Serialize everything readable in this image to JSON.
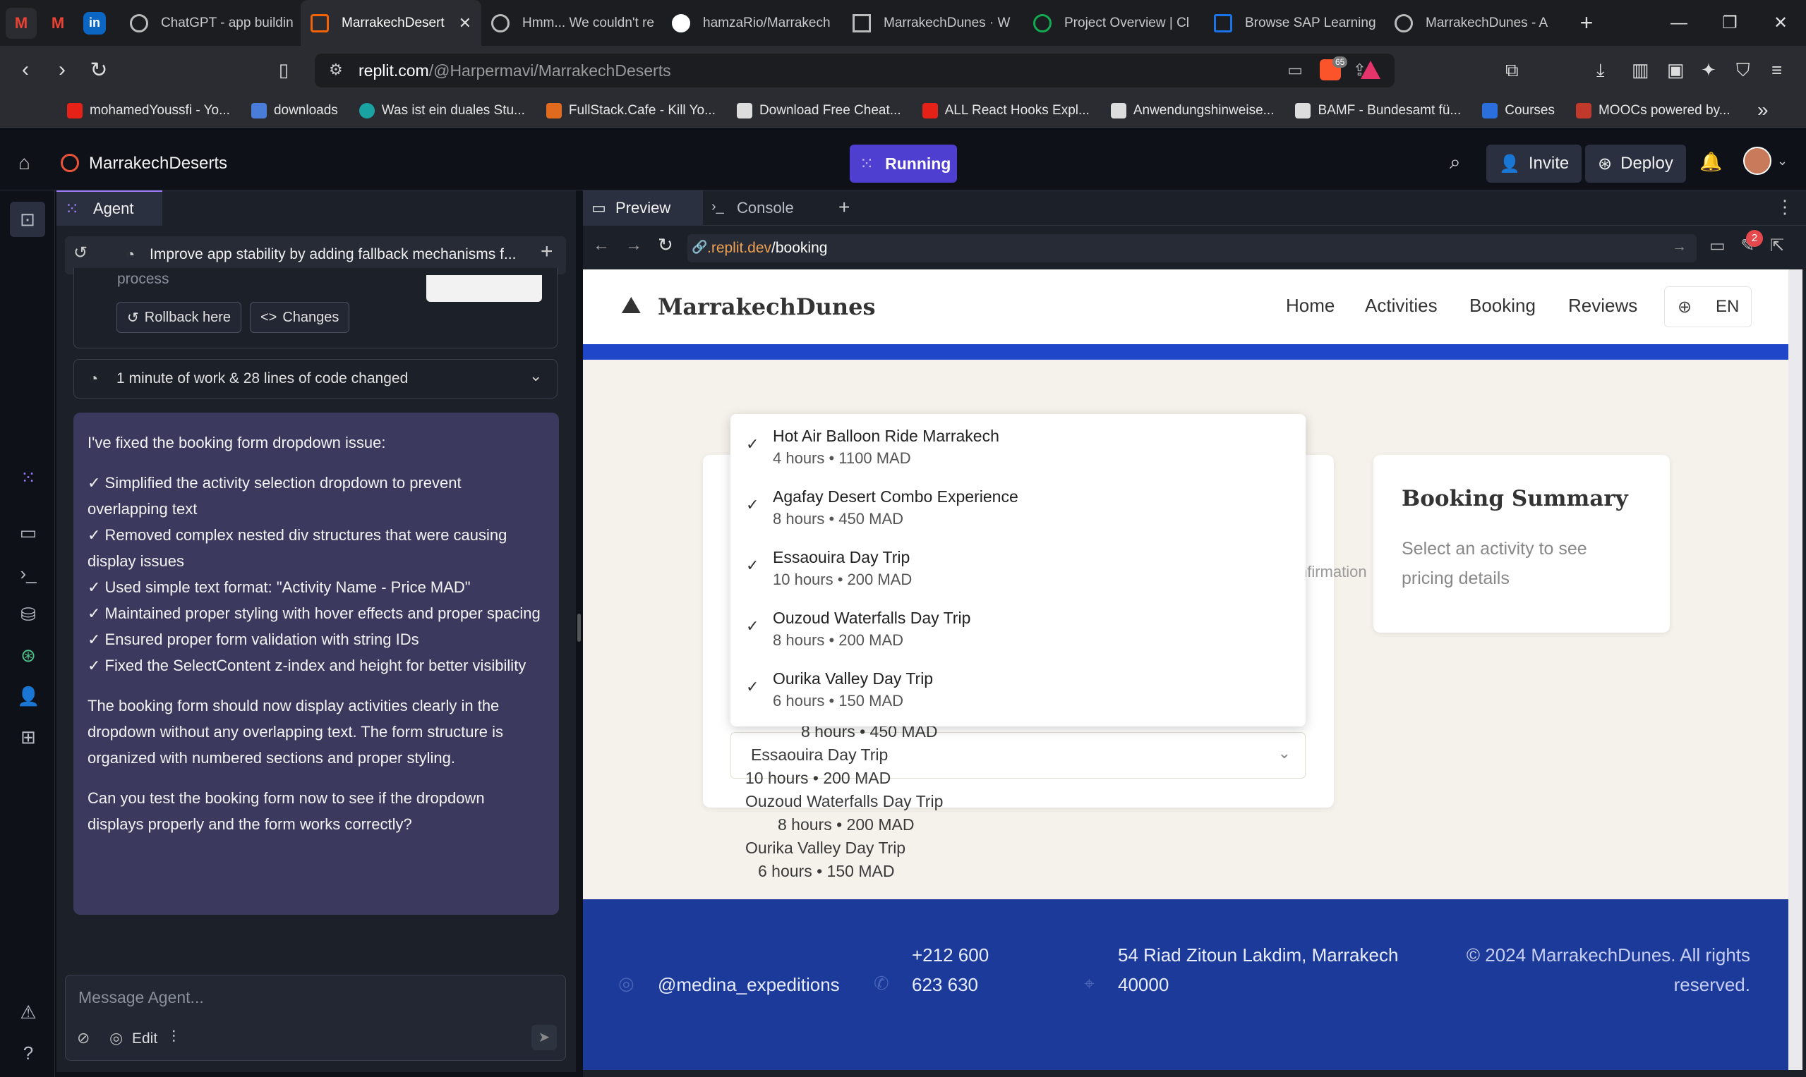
{
  "browser": {
    "tabs": [
      {
        "label": "ChatGPT - app buildin"
      },
      {
        "label": "MarrakechDesert"
      },
      {
        "label": "Hmm... We couldn't re"
      },
      {
        "label": "hamzaRio/Marrakech"
      },
      {
        "label": "MarrakechDunes · W"
      },
      {
        "label": "Project Overview | Cl"
      },
      {
        "label": "Browse SAP Learning"
      },
      {
        "label": "MarrakechDunes - A"
      }
    ],
    "url_host": "replit.com",
    "url_path": "/@Harpermavi/MarrakechDeserts",
    "brave_badge": "65",
    "bookmarks": [
      {
        "label": "mohamedYoussfi - Yo...",
        "color": "#e62117"
      },
      {
        "label": "downloads",
        "color": "#4a7cd9"
      },
      {
        "label": "Was ist ein duales Stu...",
        "color": "#1aa3a3"
      },
      {
        "label": "FullStack.Cafe - Kill Yo...",
        "color": "#e06b1f"
      },
      {
        "label": "Download Free Cheat...",
        "color": "#dddddd"
      },
      {
        "label": "ALL React Hooks Expl...",
        "color": "#e62117"
      },
      {
        "label": "Anwendungshinweise...",
        "color": "#dddddd"
      },
      {
        "label": "BAMF - Bundesamt fü...",
        "color": "#dddddd"
      },
      {
        "label": "Courses",
        "color": "#2a6fdb"
      },
      {
        "label": "MOOCs powered by...",
        "color": "#c0392b"
      }
    ]
  },
  "replit": {
    "project_name": "MarrakechDeserts",
    "run_status": "Running",
    "invite_label": "Invite",
    "deploy_label": "Deploy"
  },
  "agent": {
    "tab_label": "Agent",
    "history_title": "Improve app stability by adding fallback mechanisms f...",
    "prev_step_text": "process",
    "rollback_label": "Rollback here",
    "changes_label": "Changes",
    "work_summary": "1 minute of work & 28 lines of code changed",
    "message_intro": "I've fixed the booking form dropdown issue:",
    "message_items": [
      "✓ Simplified the activity selection dropdown to prevent overlapping text",
      "✓ Removed complex nested div structures that were causing display issues",
      "✓ Used simple text format: \"Activity Name - Price MAD\"",
      "✓ Maintained proper styling with hover effects and proper spacing",
      "✓ Ensured proper form validation with string IDs",
      "✓ Fixed the SelectContent z-index and height for better visibility"
    ],
    "message_p2": "The booking form should now display activities clearly in the dropdown without any overlapping text. The form structure is organized with numbered sections and proper styling.",
    "message_p3": "Can you test the booking form now to see if the dropdown displays properly and the form works correctly?",
    "input_placeholder": "Message Agent...",
    "edit_label": "Edit"
  },
  "preview": {
    "tab_preview": "Preview",
    "tab_console": "Console",
    "url_domain": ".replit.dev",
    "url_path": "/booking",
    "notification_count": "2"
  },
  "site": {
    "brand": "MarrakechDunes",
    "nav": [
      "Home",
      "Activities",
      "Booking",
      "Reviews"
    ],
    "lang": "EN",
    "hidden_text": "nfirmation",
    "summary_title": "Booking Summary",
    "summary_text": "Select an activity to see pricing details",
    "options": [
      {
        "name": "Hot Air Balloon Ride Marrakech",
        "detail": "4 hours • 1100 MAD"
      },
      {
        "name": "Agafay Desert Combo Experience",
        "detail": "8 hours • 450 MAD"
      },
      {
        "name": "Essaouira Day Trip",
        "detail": "10 hours • 200 MAD"
      },
      {
        "name": "Ouzoud Waterfalls Day Trip",
        "detail": "8 hours • 200 MAD"
      },
      {
        "name": "Ourika Valley Day Trip",
        "detail": "6 hours • 150 MAD"
      }
    ],
    "ghost": {
      "d1": "8 hours • 450 MAD",
      "selected": "Essaouira Day Trip",
      "d2": "10 hours • 200 MAD",
      "n3": "Ouzoud Waterfalls Day Trip",
      "d3": "8 hours • 200 MAD",
      "n4": "Ourika Valley Day Trip",
      "d4": "6 hours • 150 MAD"
    },
    "footer": {
      "instagram": "@medina_expeditions",
      "phone": "+212 600 623 630",
      "address": "54 Riad Zitoun Lakdim, Marrakech 40000",
      "copyright": "© 2024 MarrakechDunes. All rights reserved."
    }
  },
  "colors": {
    "running_bg": "#4f3fd1",
    "agent_msg_bg": "#3b3a5e",
    "site_blue": "#1f46c8",
    "footer_blue": "#1c3a9a"
  }
}
